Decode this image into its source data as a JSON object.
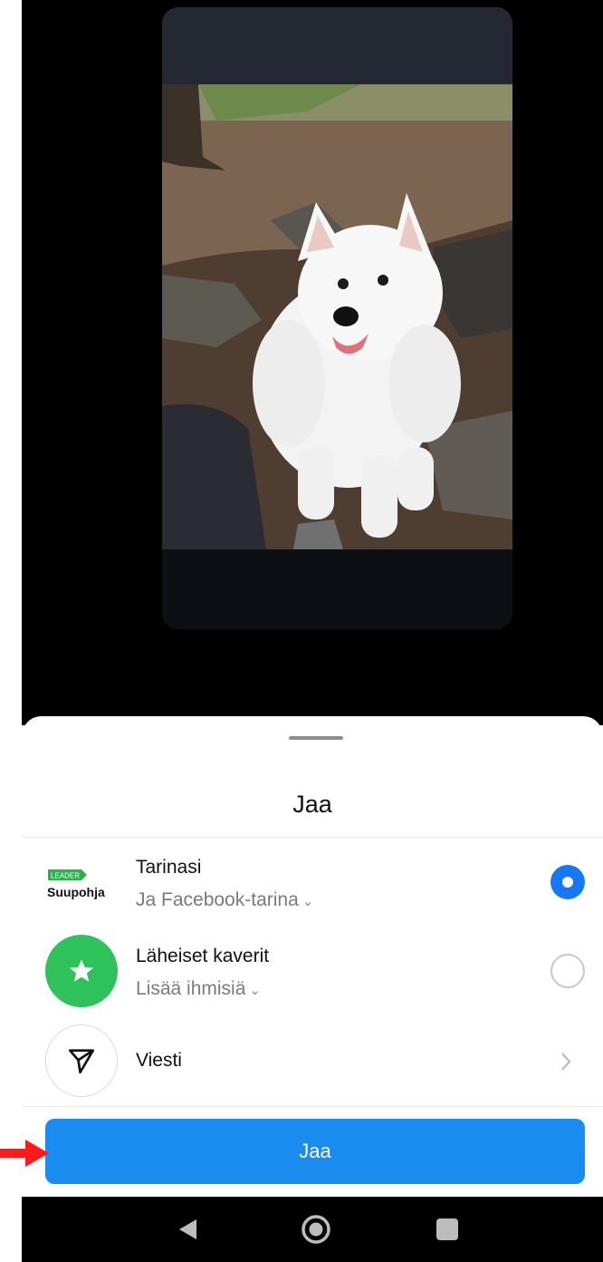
{
  "sheet": {
    "title": "Jaa",
    "options": [
      {
        "title": "Tarinasi",
        "subtitle": "Ja Facebook-tarina",
        "control": "radio-selected"
      },
      {
        "title": "Läheiset kaverit",
        "subtitle": "Lisää ihmisiä",
        "control": "radio-unselected"
      },
      {
        "title": "Viesti",
        "control": "chevron-right"
      }
    ],
    "share_button": "Jaa"
  },
  "profile_logo": {
    "badge": "LEADER",
    "name": "Suupohja"
  },
  "colors": {
    "accent": "#1877f2",
    "share_button": "#1a8cf0",
    "close_friends": "#2fc25b",
    "arrow": "#ff1a1a"
  },
  "icons": {
    "close_friends": "star-icon",
    "message": "send-arrow-icon",
    "nav": [
      "back-triangle-icon",
      "home-circle-icon",
      "recents-square-icon"
    ]
  }
}
